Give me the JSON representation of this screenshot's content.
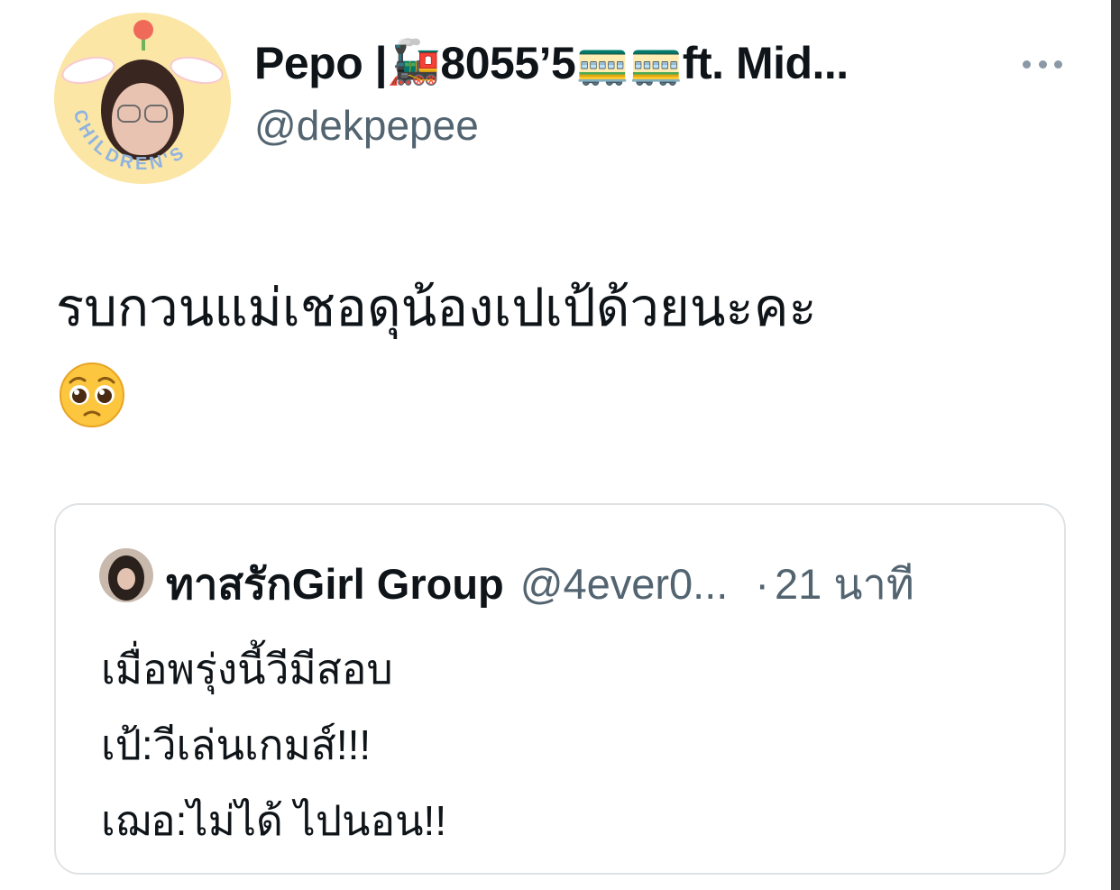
{
  "author": {
    "name_prefix": "Pepo | ",
    "name_icon_1": "🚂",
    "name_number": "8055’5",
    "name_icon_2": "🚃",
    "name_icon_3": "🚃",
    "name_suffix": " ft. Mid...",
    "handle": "@dekpepee",
    "avatar_ring_text": "CHILDREN'S"
  },
  "tweet": {
    "text": "รบกวนแม่เชอดุน้องเปเป้ด้วยนะคะ",
    "emoji": "pleading-face-emoji"
  },
  "quoted": {
    "name": "ทาสรักGirl Group",
    "handle": "@4ever0...",
    "dot": "·",
    "time": "21 นาที",
    "lines": [
      "เมื่อพรุ่งนี้วีมีสอบ",
      "เป้:วีเล่นเกมส์!!!",
      "เฌอ:ไม่ได้ ไปนอน!!"
    ]
  },
  "colors": {
    "text": "#0f1419",
    "secondary": "#536471",
    "border": "#dfe3e6"
  }
}
